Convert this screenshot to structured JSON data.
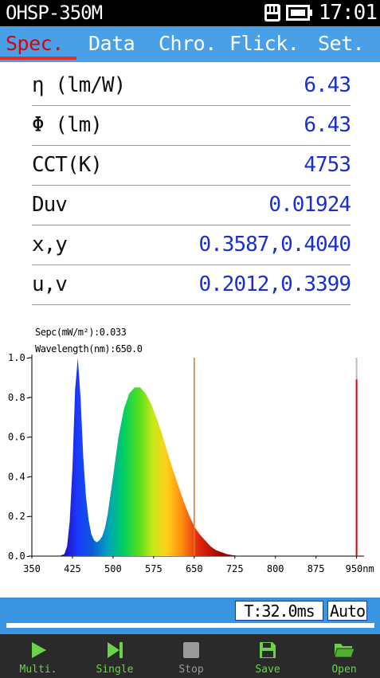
{
  "status_bar": {
    "device_name": "OHSP-350M",
    "time": "17:01"
  },
  "tabs": [
    {
      "label": "Spec.",
      "active": true
    },
    {
      "label": "Data",
      "active": false
    },
    {
      "label": "Chro.",
      "active": false
    },
    {
      "label": "Flick.",
      "active": false
    },
    {
      "label": "Set.",
      "active": false
    }
  ],
  "metrics": [
    {
      "label": "η (lm/W)",
      "value": "6.43"
    },
    {
      "label": "Φ (lm)",
      "value": "6.43"
    },
    {
      "label": "CCT(K)",
      "value": "4753"
    },
    {
      "label": "Duv",
      "value": "0.01924"
    },
    {
      "label": "x,y",
      "value": "0.3587,0.4040"
    },
    {
      "label": "u,v",
      "value": "0.2012,0.3399"
    }
  ],
  "readout": {
    "spec": "Sepc(mW/m²):0.033",
    "wavelength": "Wavelength(nm):650.0"
  },
  "chart_data": {
    "type": "area",
    "x_unit": "nm",
    "xlim": [
      350,
      955
    ],
    "ylim": [
      0,
      1.0
    ],
    "x_ticks": [
      "350",
      "425",
      "500",
      "575",
      "650",
      "725",
      "800",
      "875",
      "950"
    ],
    "y_ticks": [
      "0.0",
      "0.2",
      "0.4",
      "0.6",
      "0.8",
      "1.0"
    ],
    "grid": false,
    "cursor_nm": 650.0,
    "cursor_color": "#e07810",
    "marker_line_nm": 950,
    "marker_line_color": "#e00000",
    "marker_line_value": 0.89,
    "x": [
      380,
      400,
      410,
      415,
      420,
      425,
      430,
      435,
      440,
      445,
      450,
      455,
      460,
      465,
      470,
      475,
      480,
      485,
      490,
      500,
      510,
      520,
      530,
      540,
      550,
      560,
      570,
      580,
      590,
      600,
      610,
      620,
      630,
      640,
      650,
      660,
      670,
      680,
      690,
      700,
      710,
      720,
      730,
      740,
      750,
      760
    ],
    "y": [
      0.0,
      0.0,
      0.01,
      0.05,
      0.18,
      0.45,
      0.84,
      1.0,
      0.8,
      0.5,
      0.3,
      0.18,
      0.11,
      0.08,
      0.07,
      0.08,
      0.1,
      0.14,
      0.21,
      0.4,
      0.6,
      0.74,
      0.82,
      0.85,
      0.85,
      0.82,
      0.77,
      0.7,
      0.62,
      0.53,
      0.44,
      0.36,
      0.28,
      0.21,
      0.15,
      0.11,
      0.08,
      0.05,
      0.03,
      0.02,
      0.01,
      0.005,
      0.002,
      0.0,
      0.0,
      0.0
    ]
  },
  "controls": {
    "integration_time": "T:32.0ms",
    "mode": "Auto",
    "progress": 0.0
  },
  "toolbar": [
    {
      "label": "Multi.",
      "icon": "play-icon",
      "color": "#6bd34a"
    },
    {
      "label": "Single",
      "icon": "step-icon",
      "color": "#6bd34a"
    },
    {
      "label": "Stop",
      "icon": "stop-icon",
      "color": "#9a9a9a"
    },
    {
      "label": "Save",
      "icon": "save-icon",
      "color": "#6bd34a"
    },
    {
      "label": "Open",
      "icon": "folder-icon",
      "color": "#6bd34a"
    }
  ]
}
